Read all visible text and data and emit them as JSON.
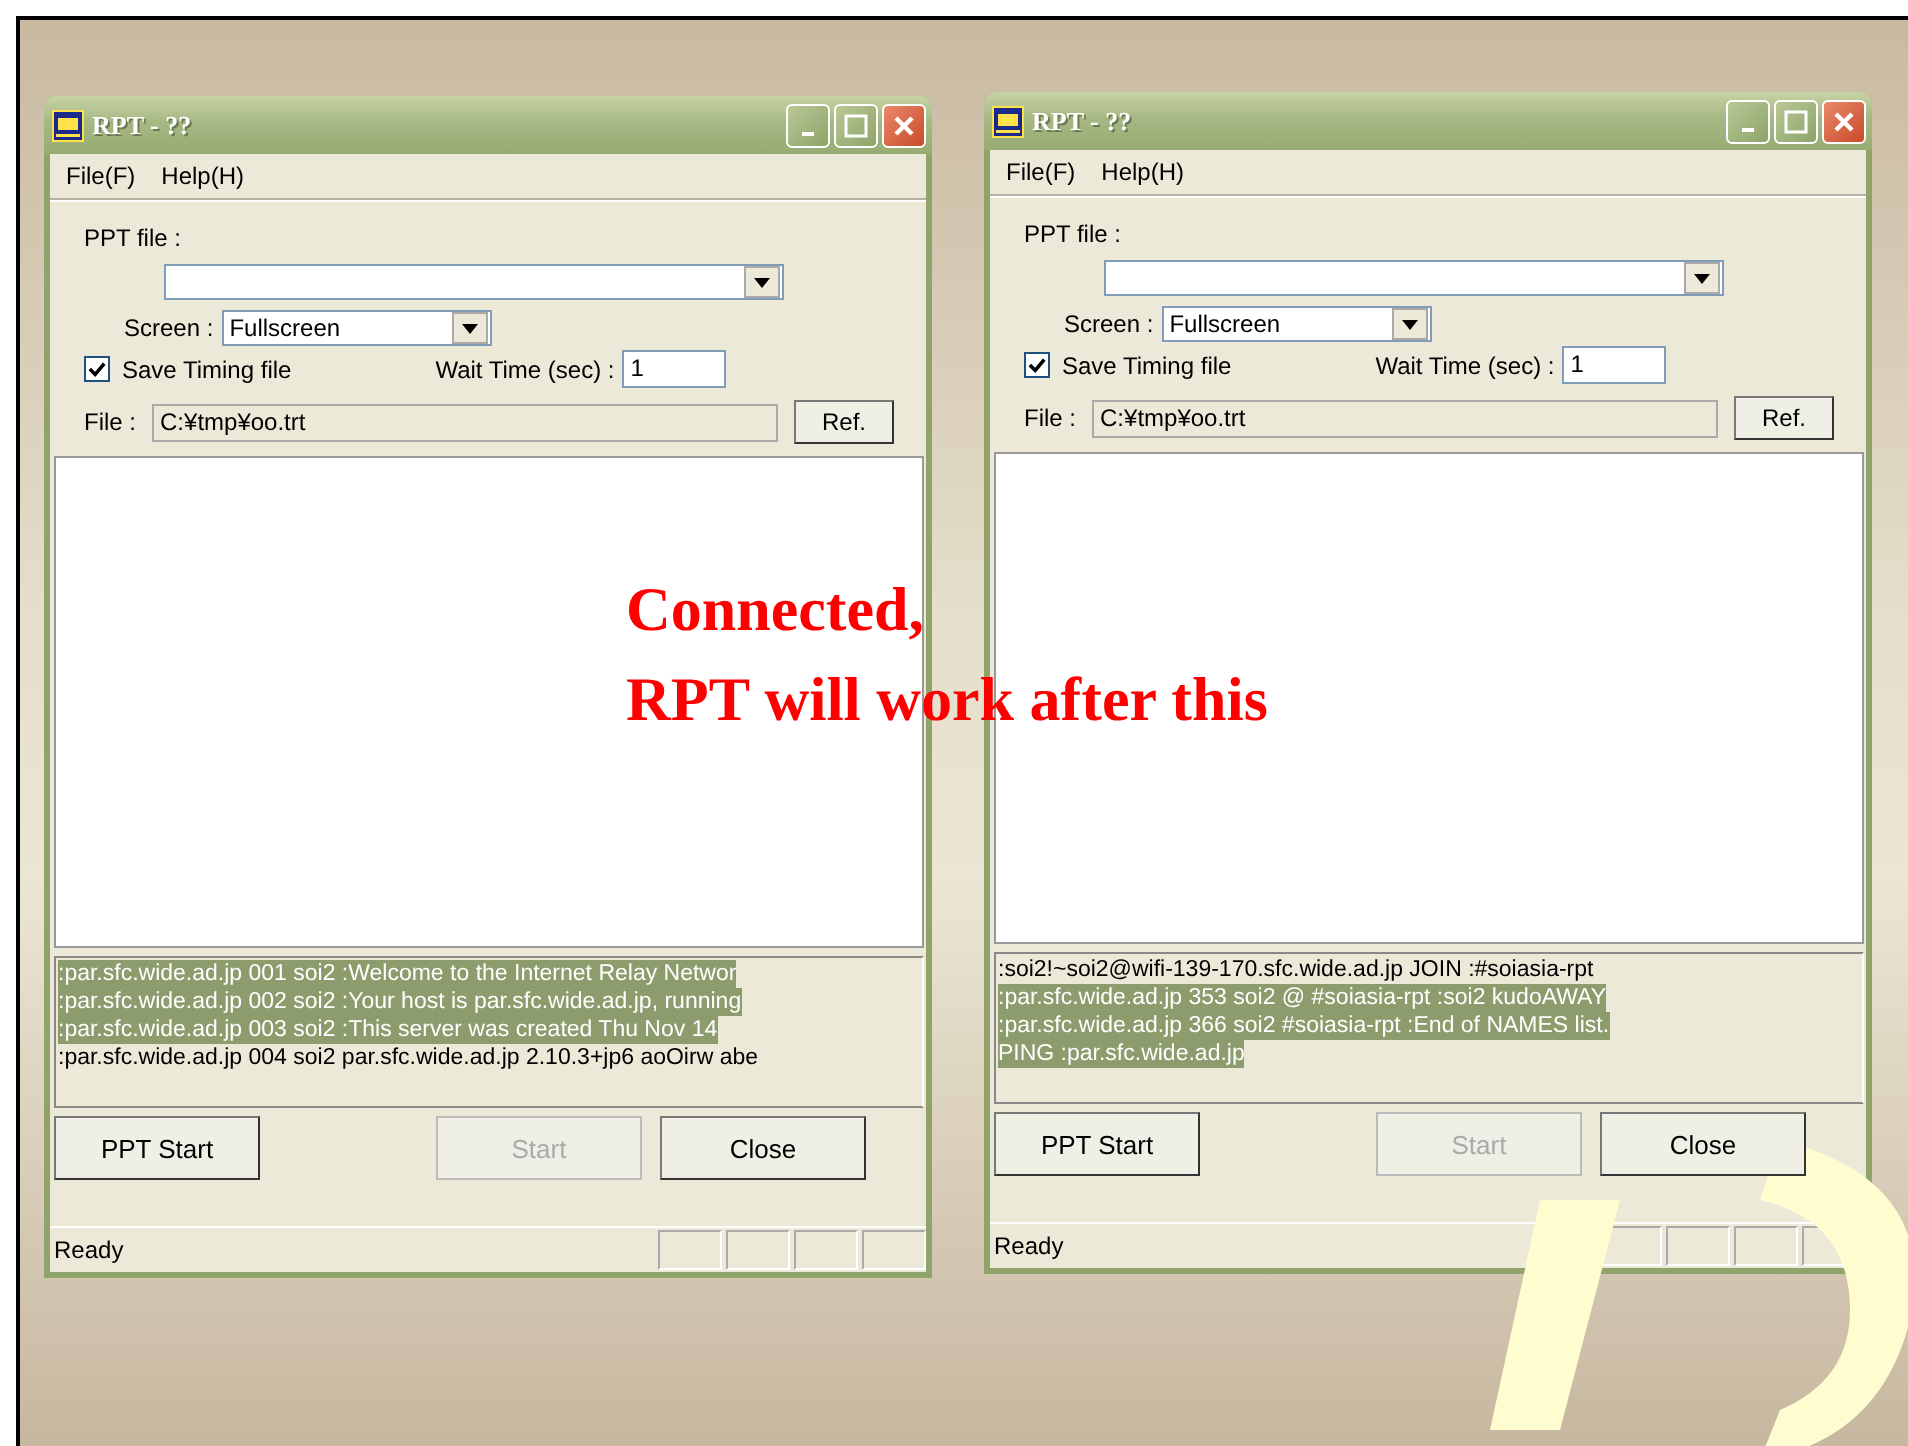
{
  "windows": [
    {
      "title": "RPT - ??",
      "menu": [
        "File(F)",
        "Help(H)"
      ],
      "ppt_file_label": "PPT file :",
      "screen_label": "Screen :",
      "screen_value": "Fullscreen",
      "save_timing": {
        "label": "Save Timing file",
        "checked": true
      },
      "wait_label": "Wait Time (sec) :",
      "wait_value": "1",
      "file_label": "File :",
      "file_value": "C:¥tmp¥oo.trt",
      "ref_button": "Ref.",
      "log": [
        {
          "text": ":par.sfc.wide.ad.jp 001 soi2 :Welcome to the Internet Relay Networ",
          "selected": true
        },
        {
          "text": ":par.sfc.wide.ad.jp 002 soi2 :Your host is par.sfc.wide.ad.jp, running",
          "selected": true
        },
        {
          "text": ":par.sfc.wide.ad.jp 003 soi2 :This server was created Thu Nov 14",
          "selected": true
        },
        {
          "text": ":par.sfc.wide.ad.jp 004 soi2 par.sfc.wide.ad.jp 2.10.3+jp6 aoOirw abe",
          "selected": false
        }
      ],
      "buttons": [
        {
          "label": "PPT Start",
          "disabled": false
        },
        {
          "label": "Start",
          "disabled": true
        },
        {
          "label": "Close",
          "disabled": false
        }
      ],
      "status": "Ready"
    },
    {
      "title": "RPT - ??",
      "menu": [
        "File(F)",
        "Help(H)"
      ],
      "ppt_file_label": "PPT file :",
      "screen_label": "Screen :",
      "screen_value": "Fullscreen",
      "save_timing": {
        "label": "Save Timing file",
        "checked": true
      },
      "wait_label": "Wait Time (sec) :",
      "wait_value": "1",
      "file_label": "File :",
      "file_value": "C:¥tmp¥oo.trt",
      "ref_button": "Ref.",
      "log": [
        {
          "text": ":soi2!~soi2@wifi-139-170.sfc.wide.ad.jp  JOIN :#soiasia-rpt",
          "selected": false
        },
        {
          "text": ":par.sfc.wide.ad.jp 353 soi2 @ #soiasia-rpt :soi2 kudoAWAY",
          "selected": true
        },
        {
          "text": ":par.sfc.wide.ad.jp 366 soi2 #soiasia-rpt :End of NAMES list.",
          "selected": true
        },
        {
          "text": "PING :par.sfc.wide.ad.jp",
          "selected": true
        }
      ],
      "buttons": [
        {
          "label": "PPT Start",
          "disabled": false
        },
        {
          "label": "Start",
          "disabled": true
        },
        {
          "label": "Close",
          "disabled": false
        }
      ],
      "status": "Ready"
    }
  ],
  "caption": [
    "Connected,",
    "RPT will work after this"
  ]
}
